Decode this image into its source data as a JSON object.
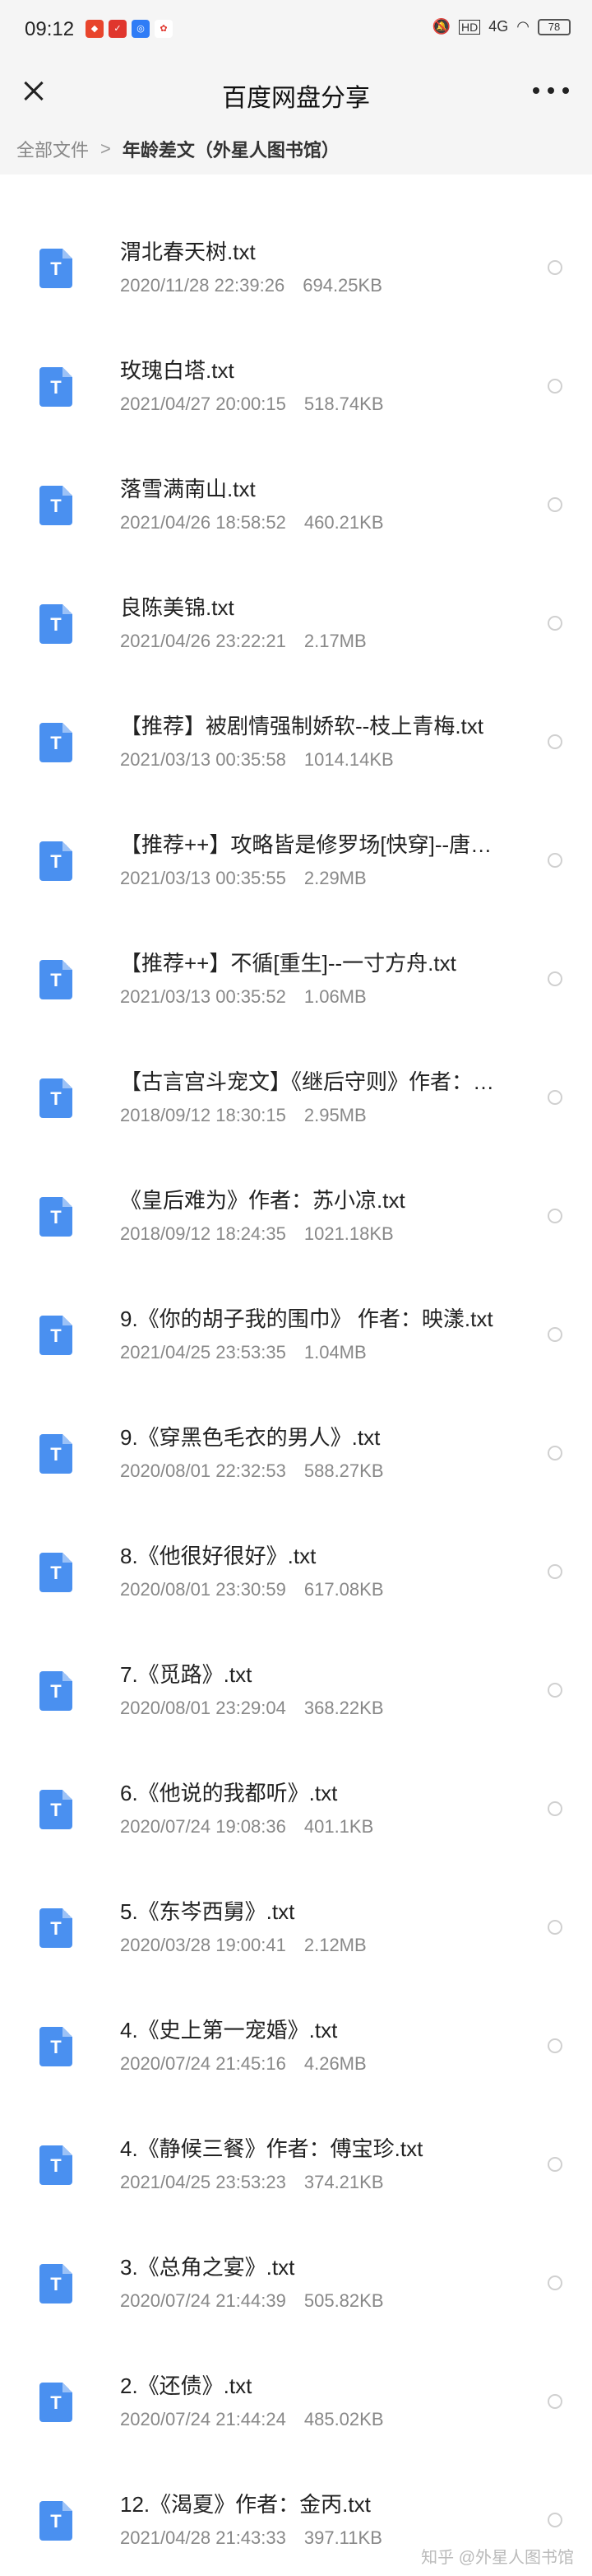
{
  "status_bar": {
    "time": "09:12",
    "app_icons": [
      {
        "name": "app-icon-1",
        "color": "#e8452c",
        "glyph": "◆"
      },
      {
        "name": "app-icon-2",
        "color": "#e0362d",
        "glyph": "✓"
      },
      {
        "name": "app-icon-3",
        "color": "#2f7cf6",
        "glyph": "◎"
      },
      {
        "name": "weibo-icon",
        "color": "#ffffff",
        "glyph": "✿"
      }
    ],
    "network": "4G",
    "battery": "78"
  },
  "header": {
    "title": "百度网盘分享"
  },
  "breadcrumb": {
    "root": "全部文件",
    "separator": ">",
    "current": "年龄差文（外星人图书馆）"
  },
  "files": [
    {
      "name": "渭北春天树.txt",
      "date": "2020/11/28 22:39:26",
      "size": "694.25KB"
    },
    {
      "name": "玫瑰白塔.txt",
      "date": "2021/04/27 20:00:15",
      "size": "518.74KB"
    },
    {
      "name": "落雪满南山.txt",
      "date": "2021/04/26 18:58:52",
      "size": "460.21KB"
    },
    {
      "name": "良陈美锦.txt",
      "date": "2021/04/26 23:22:21",
      "size": "2.17MB"
    },
    {
      "name": "【推荐】被剧情强制娇软--枝上青梅.txt",
      "date": "2021/03/13 00:35:58",
      "size": "1014.14KB"
    },
    {
      "name": "【推荐++】攻略皆是修罗场[快穿]--唐…",
      "date": "2021/03/13 00:35:55",
      "size": "2.29MB"
    },
    {
      "name": "【推荐++】不循[重生]--一寸方舟.txt",
      "date": "2021/03/13 00:35:52",
      "size": "1.06MB"
    },
    {
      "name": "【古言宫斗宠文】《继后守则》作者：…",
      "date": "2018/09/12 18:30:15",
      "size": "2.95MB"
    },
    {
      "name": "《皇后难为》作者：苏小凉.txt",
      "date": "2018/09/12 18:24:35",
      "size": "1021.18KB"
    },
    {
      "name": "9.《你的胡子我的围巾》 作者：映漾.txt",
      "date": "2021/04/25 23:53:35",
      "size": "1.04MB"
    },
    {
      "name": "9.《穿黑色毛衣的男人》.txt",
      "date": "2020/08/01 22:32:53",
      "size": "588.27KB"
    },
    {
      "name": "8.《他很好很好》.txt",
      "date": "2020/08/01 23:30:59",
      "size": "617.08KB"
    },
    {
      "name": "7.《觅路》.txt",
      "date": "2020/08/01 23:29:04",
      "size": "368.22KB"
    },
    {
      "name": "6.《他说的我都听》.txt",
      "date": "2020/07/24 19:08:36",
      "size": "401.1KB"
    },
    {
      "name": "5.《东岑西舅》.txt",
      "date": "2020/03/28 19:00:41",
      "size": "2.12MB"
    },
    {
      "name": "4.《史上第一宠婚》.txt",
      "date": "2020/07/24 21:45:16",
      "size": "4.26MB"
    },
    {
      "name": "4.《静候三餐》作者：傅宝珍.txt",
      "date": "2021/04/25 23:53:23",
      "size": "374.21KB"
    },
    {
      "name": "3.《总角之宴》.txt",
      "date": "2020/07/24 21:44:39",
      "size": "505.82KB"
    },
    {
      "name": "2.《还债》.txt",
      "date": "2020/07/24 21:44:24",
      "size": "485.02KB"
    },
    {
      "name": "12.《渴夏》作者：金丙.txt",
      "date": "2021/04/28 21:43:33",
      "size": "397.11KB"
    }
  ],
  "file_icon_letter": "T",
  "watermark": "知乎 @外星人图书馆"
}
